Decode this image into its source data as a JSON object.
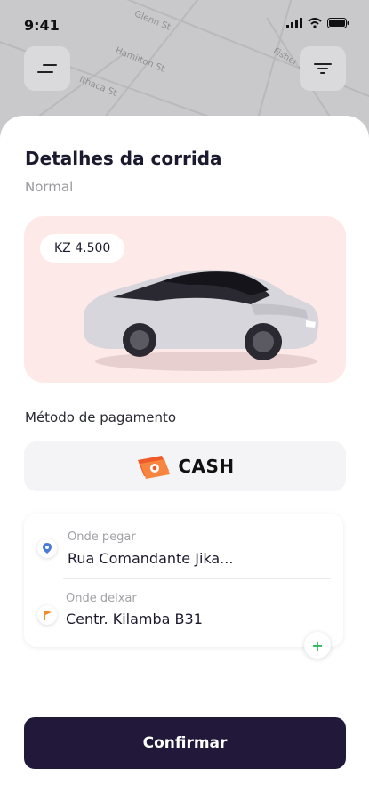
{
  "status_bar": {
    "time": "9:41"
  },
  "map": {
    "streets": [
      "Glenn St",
      "Hamilton St",
      "Ithaca St",
      "Fisher St"
    ]
  },
  "header": {
    "menu_icon": "menu-icon",
    "filter_icon": "filter-icon"
  },
  "ride": {
    "title": "Detalhes da corrida",
    "category": "Normal",
    "price": "KZ 4.500"
  },
  "payment": {
    "label": "Método de pagamento",
    "method": "CASH"
  },
  "route": {
    "pickup_hint": "Onde pegar",
    "pickup_value": "Rua Comandante Jika...",
    "dropoff_hint": "Onde deixar",
    "dropoff_value": "Centr. Kilamba B31",
    "add_stop_symbol": "+"
  },
  "actions": {
    "confirm_label": "Confirmar"
  },
  "colors": {
    "primary": "#22193a",
    "card_bg": "#fde9e8",
    "cash_orange": "#f05a28",
    "add_green": "#2eb85c"
  }
}
